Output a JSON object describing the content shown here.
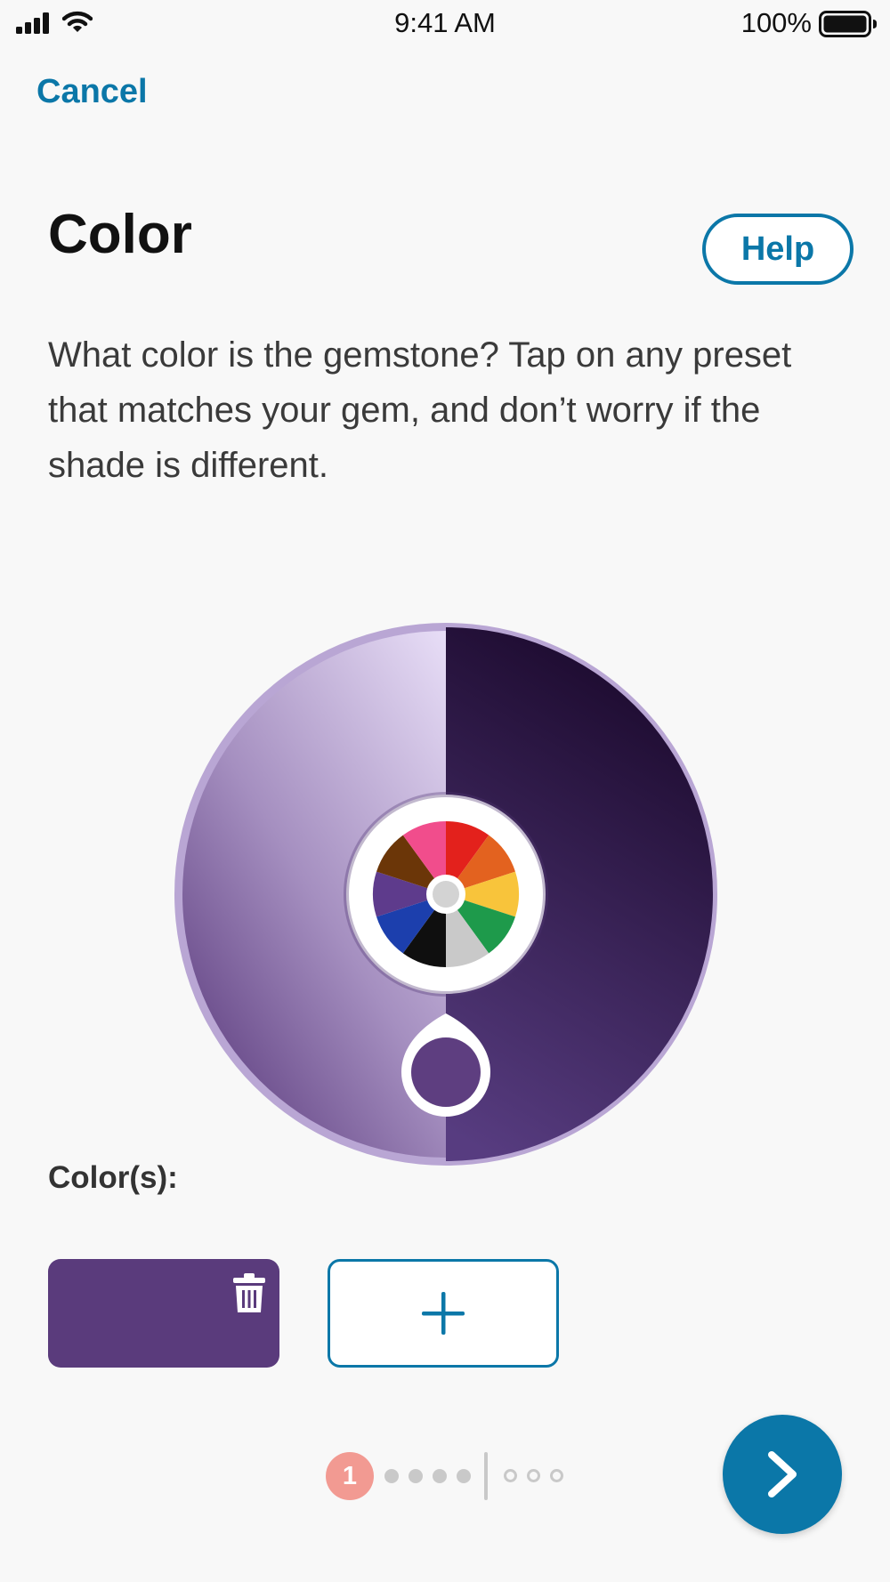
{
  "status_bar": {
    "time": "9:41 AM",
    "battery_percent": "100%",
    "icons": [
      "signal-icon",
      "wifi-icon",
      "battery-icon"
    ]
  },
  "nav": {
    "cancel_label": "Cancel"
  },
  "header": {
    "title": "Color",
    "help_label": "Help"
  },
  "description": "What color is the gemstone? Tap on any preset that matches your gem, and don’t worry if the shade is different.",
  "picker": {
    "light_shade": "#e8def7",
    "dark_shade": "#1c0a2e",
    "mid_shade": "#5a3b7c",
    "center_icon": "color-preset-wheel-icon",
    "handle_icon": "shade-handle-icon",
    "preset_colors": [
      "#e3211c",
      "#e3621f",
      "#f8c43b",
      "#1e9a4b",
      "#c9c9c9",
      "#0f0f0f",
      "#1c3fad",
      "#5e3b8c",
      "#6b3608",
      "#f14d8c"
    ]
  },
  "selection": {
    "label": "Color(s):",
    "swatches": [
      {
        "color": "#5a3b7c",
        "delete_icon": "trash-icon"
      }
    ],
    "add_icon": "plus-icon"
  },
  "progress": {
    "current_step": "1",
    "completed_dots": 4,
    "remaining_dots": 3
  },
  "next": {
    "icon": "chevron-right-icon"
  },
  "colors": {
    "accent": "#0b77a8",
    "step_badge": "#f29a92",
    "background": "#f8f8f8"
  }
}
